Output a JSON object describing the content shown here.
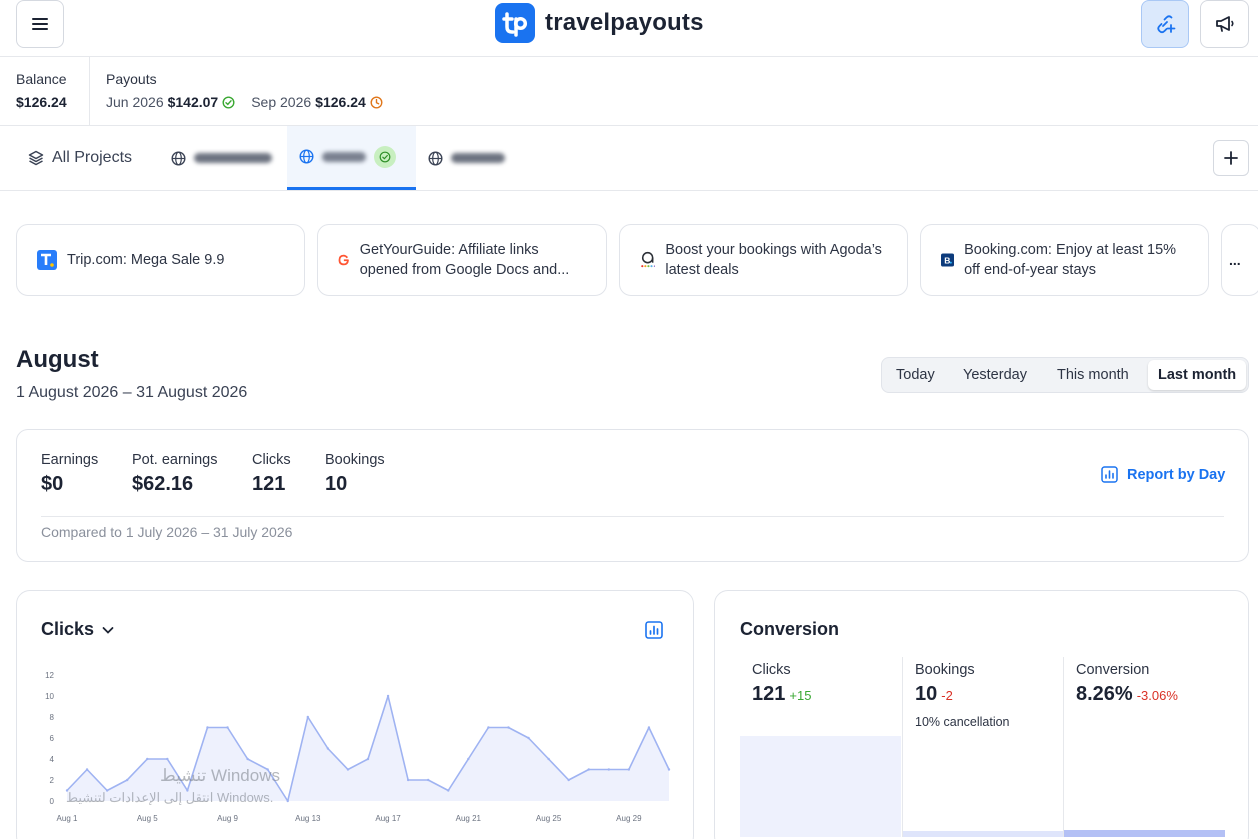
{
  "brand": {
    "name": "travelpayouts",
    "color": "#1a73f0"
  },
  "header": {
    "menu_icon": "hamburger-icon",
    "link_icon": "link-plus-icon",
    "announcement_icon": "megaphone-icon"
  },
  "balance": {
    "label": "Balance",
    "value": "$126.24"
  },
  "payouts": {
    "label": "Payouts",
    "items": [
      {
        "period": "Jun 2026",
        "amount": "$142.07",
        "status_icon": "check-circle-icon"
      },
      {
        "period": "Sep 2026",
        "amount": "$126.24",
        "status_icon": "clock-icon"
      }
    ]
  },
  "tabs": {
    "all_projects": "All Projects"
  },
  "promos": [
    {
      "text": "Trip.com: Mega Sale 9.9",
      "icon": "tripcom-logo"
    },
    {
      "text": "GetYourGuide: Affiliate links opened from Google Docs and...",
      "icon": "getyourguide-logo"
    },
    {
      "text": "Boost your bookings with Agoda’s latest deals",
      "icon": "agoda-logo"
    },
    {
      "text": "Booking.com: Enjoy at least 15% off end-of-year stays",
      "icon": "booking-logo"
    }
  ],
  "promo_more": "...",
  "period": {
    "title": "August",
    "range": "1 August 2026 – 31 August 2026"
  },
  "range_selector": {
    "today": "Today",
    "yesterday": "Yesterday",
    "this_month": "This month",
    "last_month": "Last month",
    "selected": "Last month"
  },
  "summary": {
    "earnings_label": "Earnings",
    "earnings_value": "$0",
    "pot_label": "Pot. earnings",
    "pot_value": "$62.16",
    "clicks_label": "Clicks",
    "clicks_value": "121",
    "bookings_label": "Bookings",
    "bookings_value": "10",
    "report_link": "Report by Day",
    "compare": "Compared to 1 July 2026 – 31 July 2026"
  },
  "clicks_card": {
    "title": "Clicks"
  },
  "chart_data": {
    "type": "area",
    "title": "Clicks",
    "x": [
      "Aug 1",
      "Aug 2",
      "Aug 3",
      "Aug 4",
      "Aug 5",
      "Aug 6",
      "Aug 7",
      "Aug 8",
      "Aug 9",
      "Aug 10",
      "Aug 11",
      "Aug 12",
      "Aug 13",
      "Aug 14",
      "Aug 15",
      "Aug 16",
      "Aug 17",
      "Aug 18",
      "Aug 19",
      "Aug 20",
      "Aug 21",
      "Aug 22",
      "Aug 23",
      "Aug 24",
      "Aug 25",
      "Aug 26",
      "Aug 27",
      "Aug 28",
      "Aug 29",
      "Aug 30",
      "Aug 31"
    ],
    "tick_labels": [
      "Aug 1",
      "Aug 5",
      "Aug 9",
      "Aug 13",
      "Aug 17",
      "Aug 21",
      "Aug 25",
      "Aug 29"
    ],
    "tick_indices": [
      0,
      4,
      8,
      12,
      16,
      20,
      24,
      28
    ],
    "values": [
      1,
      3,
      1,
      2,
      4,
      4,
      1,
      7,
      7,
      4,
      3,
      0,
      8,
      5,
      3,
      4,
      10,
      2,
      2,
      1,
      4,
      7,
      7,
      6,
      4,
      2,
      3,
      3,
      3,
      7,
      3
    ],
    "ylim": [
      0,
      12
    ],
    "yticks": [
      0,
      2,
      4,
      6,
      8,
      10,
      12
    ],
    "grid": false,
    "line_color": "#9fb3f2",
    "fill_color": "#eef1fd"
  },
  "conversion": {
    "title": "Conversion",
    "clicks_label": "Clicks",
    "clicks_value": "121",
    "clicks_delta": "+15",
    "bookings_label": "Bookings",
    "bookings_value": "10",
    "bookings_delta": "-2",
    "cancellation": "10% cancellation",
    "conversion_label": "Conversion",
    "conversion_value": "8.26%",
    "conversion_delta": "-3.06%",
    "bar_levels": [
      0.56,
      0.035,
      0.04
    ],
    "bar_colors": [
      "#eef1fd",
      "#dfe5fb",
      "#b3c0f5"
    ]
  },
  "watermark": {
    "line1": "تنشيط Windows",
    "line2": "انتقل إلى الإعدادات لتنشيط Windows."
  }
}
